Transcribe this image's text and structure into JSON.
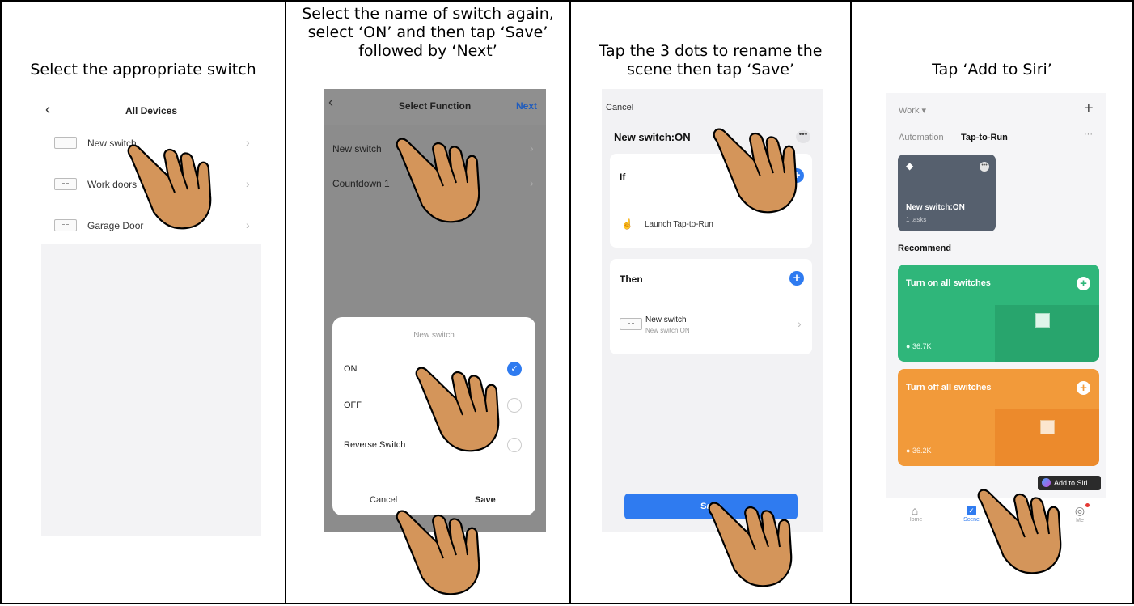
{
  "steps": [
    {
      "caption": "Select the appropriate switch"
    },
    {
      "caption": "Select the name of switch again,\nselect ‘ON’ and then tap ‘Save’\nfollowed by ‘Next’"
    },
    {
      "caption": "Tap the 3 dots to rename the\nscene then tap ‘Save’"
    },
    {
      "caption": "Tap ‘Add to Siri’"
    }
  ],
  "screen1": {
    "back_icon": "chevron-left-icon",
    "title": "All Devices",
    "devices": [
      {
        "name": "New switch"
      },
      {
        "name": "Work doors"
      },
      {
        "name": "Garage Door"
      }
    ]
  },
  "screen2": {
    "title": "Select Function",
    "next_label": "Next",
    "functions": [
      {
        "name": "New switch"
      },
      {
        "name": "Countdown 1"
      }
    ],
    "modal": {
      "title": "New switch",
      "options": [
        {
          "label": "ON",
          "selected": true
        },
        {
          "label": "OFF",
          "selected": false
        },
        {
          "label": "Reverse Switch",
          "selected": false
        }
      ],
      "cancel_label": "Cancel",
      "save_label": "Save"
    }
  },
  "screen3": {
    "cancel_label": "Cancel",
    "scene_name": "New switch:ON",
    "more_icon": "ellipsis-icon",
    "if_label": "If",
    "if_item": "Launch Tap-to-Run",
    "then_label": "Then",
    "then_item_title": "New switch",
    "then_item_sub": "New switch:ON",
    "save_label": "Save"
  },
  "screen4": {
    "home_selector": "Work",
    "tabs": [
      "Automation",
      "Tap-to-Run"
    ],
    "active_tab": "Tap-to-Run",
    "scene_card": {
      "title": "New switch:ON",
      "sub": "1 tasks"
    },
    "recommend_label": "Recommend",
    "recommend_cards": [
      {
        "title": "Turn on all switches",
        "count": "36.7K",
        "color": "#2fb67a"
      },
      {
        "title": "Turn off all switches",
        "count": "36.2K",
        "color": "#f29a3a"
      }
    ],
    "add_to_siri_label": "Add to Siri",
    "nav": [
      {
        "label": "Home",
        "icon": "home-icon"
      },
      {
        "label": "Scene",
        "icon": "scene-icon"
      },
      {
        "label": "Me",
        "icon": "profile-icon"
      }
    ]
  },
  "colors": {
    "accent": "#2f7bf0",
    "hand": "#d4955a",
    "scene_card": "#56606e"
  }
}
